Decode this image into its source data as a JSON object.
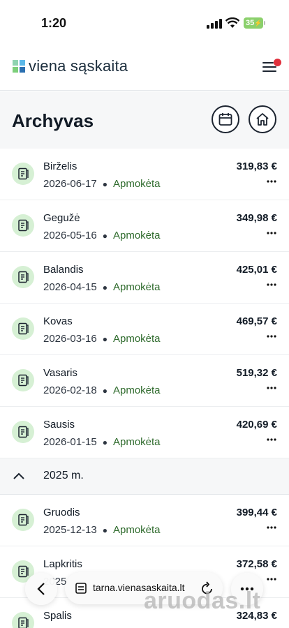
{
  "status_bar": {
    "time": "1:20",
    "battery": "35"
  },
  "header": {
    "logo_text": "viena sąskaita"
  },
  "page": {
    "title": "Archyvas"
  },
  "invoices_2026": [
    {
      "month": "Birželis",
      "date": "2026-06-17",
      "status": "Apmokėta",
      "amount": "319,83 €"
    },
    {
      "month": "Gegužė",
      "date": "2026-05-16",
      "status": "Apmokėta",
      "amount": "349,98 €"
    },
    {
      "month": "Balandis",
      "date": "2026-04-15",
      "status": "Apmokėta",
      "amount": "425,01 €"
    },
    {
      "month": "Kovas",
      "date": "2026-03-16",
      "status": "Apmokėta",
      "amount": "469,57 €"
    },
    {
      "month": "Vasaris",
      "date": "2026-02-18",
      "status": "Apmokėta",
      "amount": "519,32 €"
    },
    {
      "month": "Sausis",
      "date": "2026-01-15",
      "status": "Apmokėta",
      "amount": "420,69 €"
    }
  ],
  "year_group": {
    "label": "2025 m."
  },
  "invoices_2025": [
    {
      "month": "Gruodis",
      "date": "2025-12-13",
      "status": "Apmokėta",
      "amount": "399,44 €"
    },
    {
      "month": "Lapkritis",
      "date": "2025",
      "status": "",
      "amount": "372,58 €"
    },
    {
      "month": "Spalis",
      "date": "",
      "status": "",
      "amount": "324,83 €"
    }
  ],
  "browser": {
    "url": "tarna.vienasaskaita.lt"
  },
  "watermark": "aruodas.lt",
  "colors": {
    "accent_green": "#2f6b2d",
    "icon_bg": "#d6f0d4",
    "notification": "#e0303c"
  }
}
